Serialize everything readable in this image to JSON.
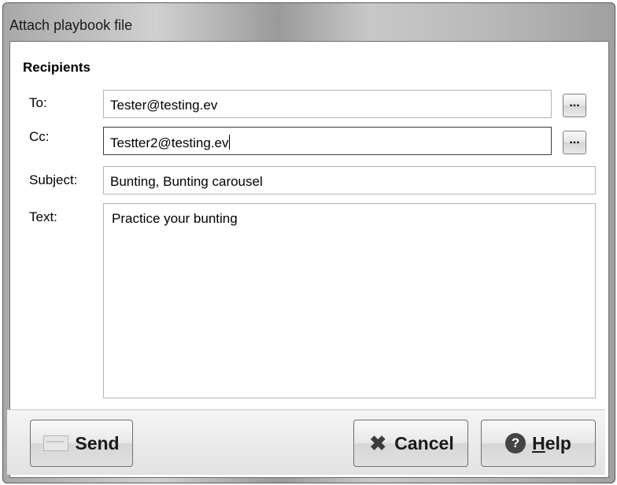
{
  "window": {
    "title": "Attach playbook file"
  },
  "section": {
    "title": "Recipients"
  },
  "fields": {
    "to": {
      "label": "To:",
      "value": "Tester@testing.ev"
    },
    "cc": {
      "label": "Cc:",
      "value": "Testter2@testing.ev"
    },
    "subject": {
      "label": "Subject:",
      "value": "Bunting, Bunting carousel"
    },
    "text": {
      "label": "Text:",
      "value": "Practice your bunting"
    }
  },
  "browse_label": "...",
  "buttons": {
    "send": "Send",
    "cancel": "Cancel",
    "help_prefix": "H",
    "help_rest": "elp"
  },
  "icons": {
    "send": "envelope-icon",
    "cancel": "x-icon",
    "help": "question-icon"
  }
}
